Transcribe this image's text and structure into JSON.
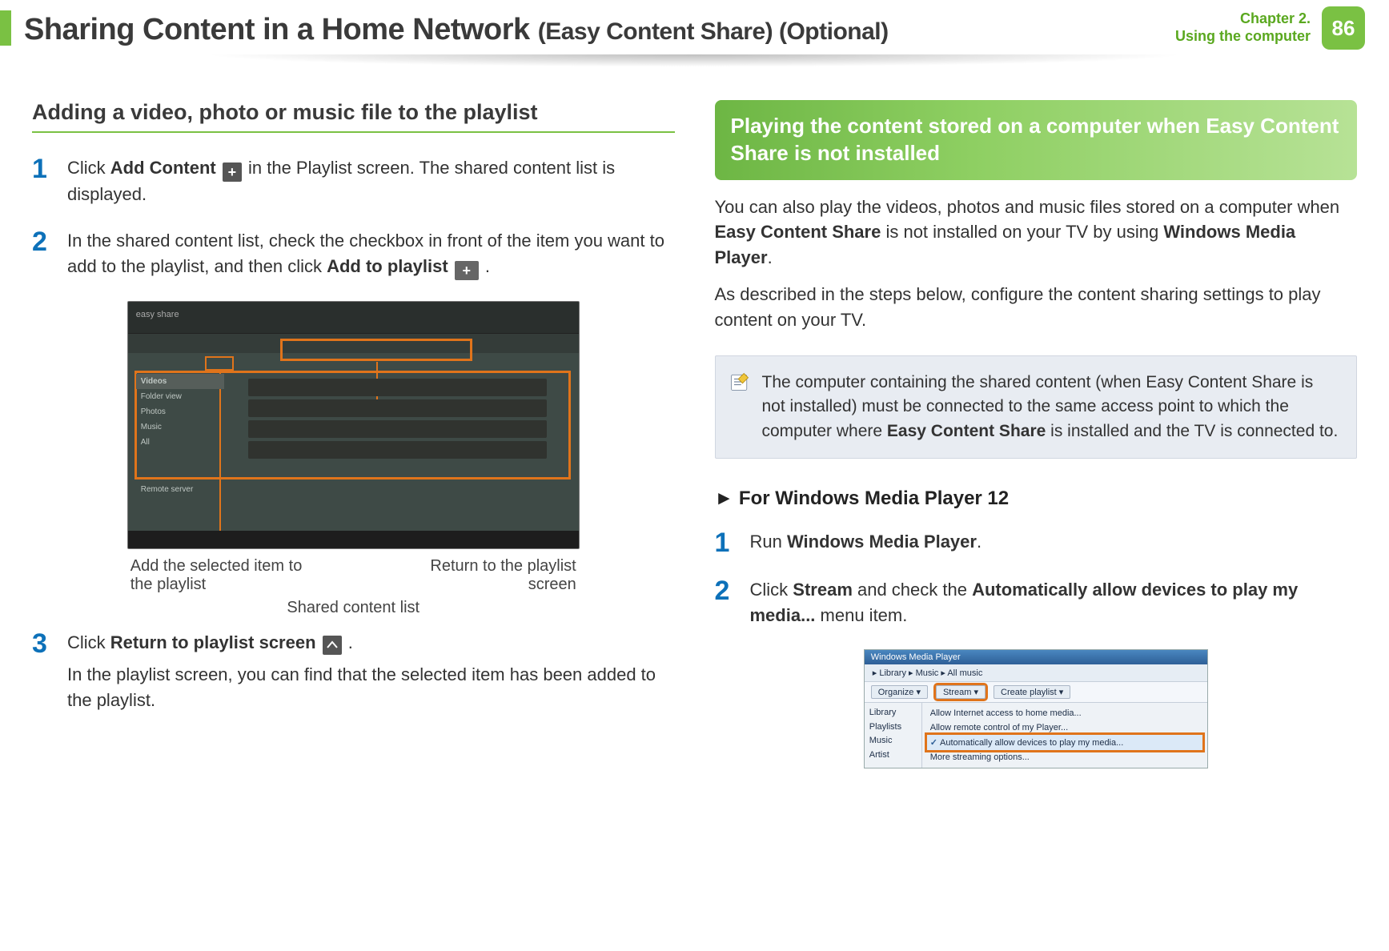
{
  "header": {
    "title_main": "Sharing Content in a Home Network",
    "title_sub": "(Easy Content Share) (Optional)",
    "chapter_line1": "Chapter 2.",
    "chapter_line2": "Using the computer",
    "page_number": "86"
  },
  "left": {
    "section_title": "Adding a video, photo or music file to the playlist",
    "steps": [
      {
        "num": "1",
        "pre": "Click ",
        "bold1": "Add Content",
        "post1": " ",
        "post2": " in the Playlist screen. The shared content list is displayed."
      },
      {
        "num": "2",
        "pre": "In the shared content list, check the checkbox in front of the item you want to add to the playlist, and then click ",
        "bold1": "Add to playlist",
        "post2": " ."
      },
      {
        "num": "3",
        "pre": "Click ",
        "bold1": "Return to playlist screen",
        "post2": " .",
        "tail": "In the playlist screen, you can find that the selected item has been added to the playlist."
      }
    ],
    "figure": {
      "label_left": "Add the selected item to the playlist",
      "label_right": "Return to the playlist screen",
      "label_center": "Shared content list",
      "sidebar": {
        "videos": "Videos",
        "folder": "Folder view",
        "photos": "Photos",
        "music": "Music",
        "all": "All",
        "remote": "Remote server"
      },
      "logo": "easy share"
    }
  },
  "right": {
    "callout": "Playing the content stored on a computer when Easy Content Share is not installed",
    "para1_pre": "You can also play the videos, photos and music files stored on a computer when ",
    "para1_b1": "Easy Content Share",
    "para1_mid": " is not installed on your TV by using ",
    "para1_b2": "Windows Media Player",
    "para1_post": ".",
    "para2": "As described in the steps below, configure the content sharing settings to play content on your TV.",
    "note_pre": "The computer containing the shared content (when Easy Content Share is not installed) must be connected to the same access point to which the computer where ",
    "note_b": "Easy Content Share",
    "note_post": " is installed and the TV is connected to.",
    "subhead": "For Windows Media Player 12",
    "steps": [
      {
        "num": "1",
        "pre": "Run ",
        "bold1": "Windows Media Player",
        "post": "."
      },
      {
        "num": "2",
        "pre": "Click ",
        "bold1": "Stream",
        "mid": " and check the ",
        "bold2": "Automatically allow devices to play my media...",
        "post": " menu item."
      }
    ],
    "wmp": {
      "title": "Windows Media Player",
      "crumb": "▸ Library ▸ Music ▸ All music",
      "organize": "Organize ▾",
      "stream": "Stream ▾",
      "create": "Create playlist ▾",
      "menu1": "Allow Internet access to home media...",
      "menu2": "Allow remote control of my Player...",
      "menu3": "Automatically allow devices to play my media...",
      "menu4": "More streaming options...",
      "nav_library": "Library",
      "nav_playlists": "Playlists",
      "nav_music": "Music",
      "nav_artist": "Artist"
    }
  }
}
